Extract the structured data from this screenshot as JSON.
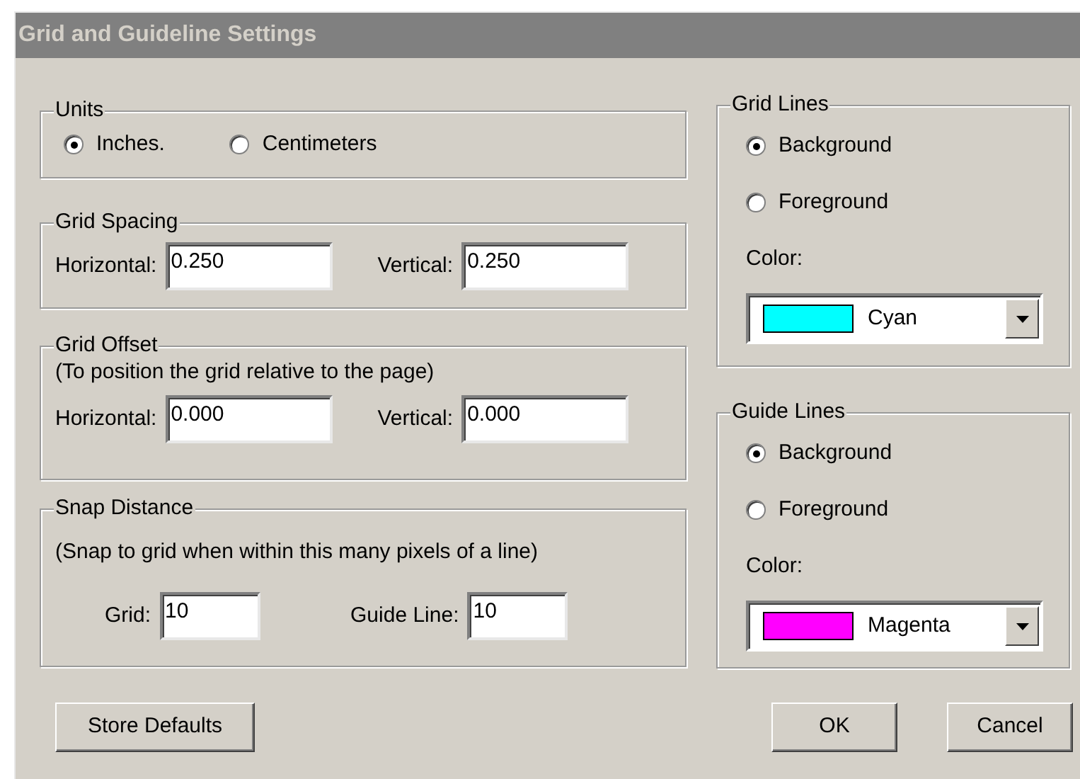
{
  "window": {
    "title": "Grid and Guideline Settings"
  },
  "units": {
    "label": "Units",
    "options": [
      {
        "label": "Inches.",
        "selected": true
      },
      {
        "label": "Centimeters",
        "selected": false
      }
    ]
  },
  "grid_spacing": {
    "label": "Grid Spacing",
    "fields": [
      {
        "label": "Horizontal:",
        "value": "0.250"
      },
      {
        "label": "Vertical:",
        "value": "0.250"
      }
    ]
  },
  "grid_offset": {
    "label": "Grid Offset",
    "note": "(To position the grid relative to the page)",
    "fields": [
      {
        "label": "Horizontal:",
        "value": "0.000"
      },
      {
        "label": "Vertical:",
        "value": "0.000"
      }
    ]
  },
  "snap_distance": {
    "label": "Snap Distance",
    "note": "(Snap to grid when within this many pixels of a line)",
    "fields": [
      {
        "label": "Grid:",
        "value": "10"
      },
      {
        "label": "Guide Line:",
        "value": "10"
      }
    ]
  },
  "grid_lines": {
    "label": "Grid Lines",
    "options": [
      {
        "label": "Background",
        "selected": true
      },
      {
        "label": "Foreground",
        "selected": false
      }
    ],
    "color_label": "Color:",
    "color_select": {
      "value": "Cyan",
      "color": "#00ffff"
    }
  },
  "guide_lines": {
    "label": "Guide Lines",
    "options": [
      {
        "label": "Background",
        "selected": true
      },
      {
        "label": "Foreground",
        "selected": false
      }
    ],
    "color_label": "Color:",
    "color_select": {
      "value": "Magenta",
      "color": "#ff00ff"
    }
  },
  "buttons": [
    "Store Defaults",
    "OK",
    "Cancel"
  ]
}
